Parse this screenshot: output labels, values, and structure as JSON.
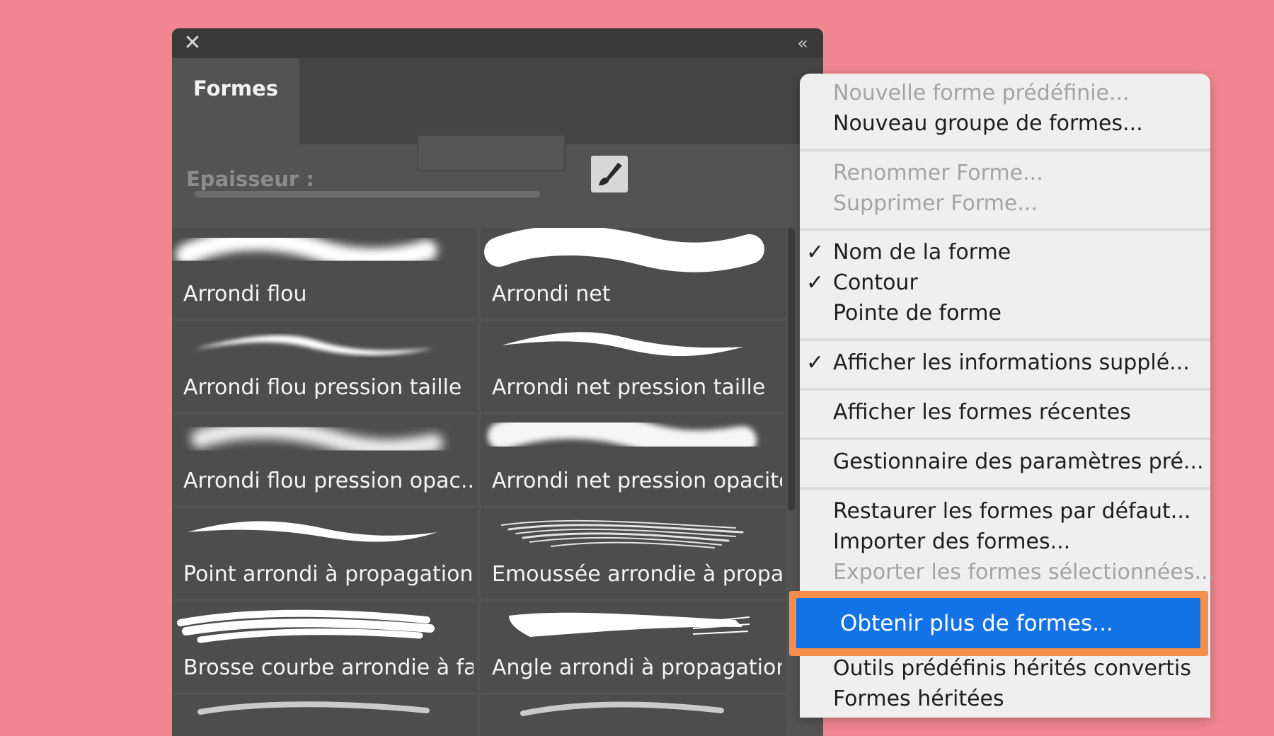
{
  "panel": {
    "title": "Formes",
    "close_icon": "close-icon",
    "collapse_icon": "collapse-icon",
    "menu_icon": "hamburger-menu-icon",
    "thickness_label": "Epaisseur :",
    "brush_settings_icon": "brush-icon"
  },
  "brushes": [
    {
      "label": "Arrondi flou"
    },
    {
      "label": "Arrondi net"
    },
    {
      "label": "Arrondi flou pression taille"
    },
    {
      "label": "Arrondi net pression taille"
    },
    {
      "label": "Arrondi flou pression opac..."
    },
    {
      "label": "Arrondi net pression opacité"
    },
    {
      "label": "Point arrondi à propagation"
    },
    {
      "label": "Emoussée arrondie à propa..."
    },
    {
      "label": "Brosse courbe arrondie à fa..."
    },
    {
      "label": "Angle arrondi à propagation"
    }
  ],
  "menu": {
    "new_preset": "Nouvelle forme prédéfinie...",
    "new_group": "Nouveau groupe de formes...",
    "rename": "Renommer Forme...",
    "delete": "Supprimer Forme...",
    "brush_name": "Nom de la forme",
    "stroke": "Contour",
    "brush_tip": "Pointe de forme",
    "show_extra": "Afficher les informations supplé...",
    "show_recent": "Afficher les formes récentes",
    "preset_manager": "Gestionnaire des paramètres pré...",
    "restore_default": "Restaurer les formes par défaut...",
    "import": "Importer des formes...",
    "export": "Exporter les formes sélectionnées...",
    "get_more": "Obtenir plus de formes...",
    "legacy_tools": "Outils prédéfinis hérités convertis",
    "legacy_brushes": "Formes héritées",
    "check_symbol": "✓"
  },
  "colors": {
    "background": "#f28690",
    "highlight": "#1272e6",
    "highlight_border": "#f58e4a"
  }
}
